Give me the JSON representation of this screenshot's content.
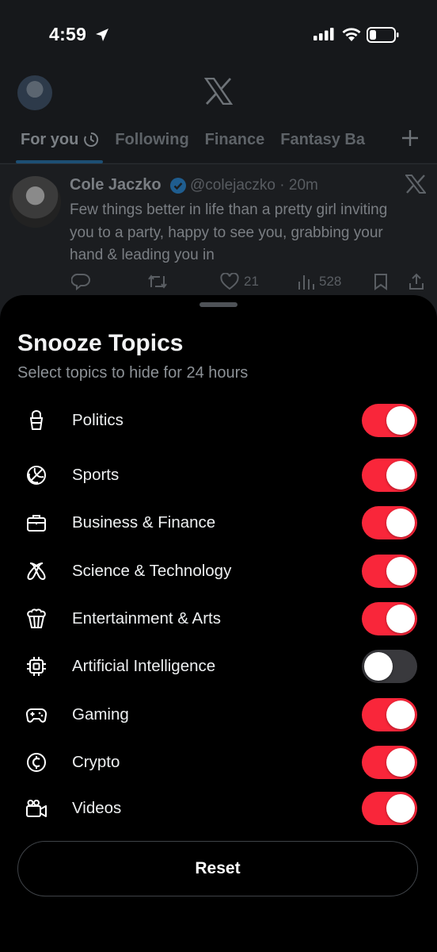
{
  "status_bar": {
    "time": "4:59"
  },
  "header": {
    "tabs": [
      {
        "label": "For you"
      },
      {
        "label": "Following"
      },
      {
        "label": "Finance"
      },
      {
        "label": "Fantasy Ba"
      }
    ]
  },
  "tweet": {
    "name": "Cole Jaczko",
    "handle_time": "@colejaczko · 20m",
    "text": "Few things better in life than a pretty girl inviting you to a party, happy to see you, grabbing your hand & leading you in",
    "likes": "21",
    "views": "528"
  },
  "sheet": {
    "title": "Snooze Topics",
    "subtitle": "Select topics to hide for 24 hours",
    "topics": [
      {
        "label": "Politics",
        "icon": "cup-icon",
        "enabled": true
      },
      {
        "label": "Sports",
        "icon": "ball-icon",
        "enabled": true
      },
      {
        "label": "Business & Finance",
        "icon": "briefcase-icon",
        "enabled": true
      },
      {
        "label": "Science & Technology",
        "icon": "atom-icon",
        "enabled": true
      },
      {
        "label": "Entertainment & Arts",
        "icon": "popcorn-icon",
        "enabled": true
      },
      {
        "label": "Artificial Intelligence",
        "icon": "chip-icon",
        "enabled": false
      },
      {
        "label": "Gaming",
        "icon": "gamepad-icon",
        "enabled": true
      },
      {
        "label": "Crypto",
        "icon": "coin-icon",
        "enabled": true
      },
      {
        "label": "Videos",
        "icon": "video-camera-icon",
        "enabled": true
      }
    ],
    "reset_label": "Reset"
  },
  "colors": {
    "toggle_on": "#f9263a",
    "toggle_off": "#39393d",
    "sheet_bg": "#000000"
  }
}
